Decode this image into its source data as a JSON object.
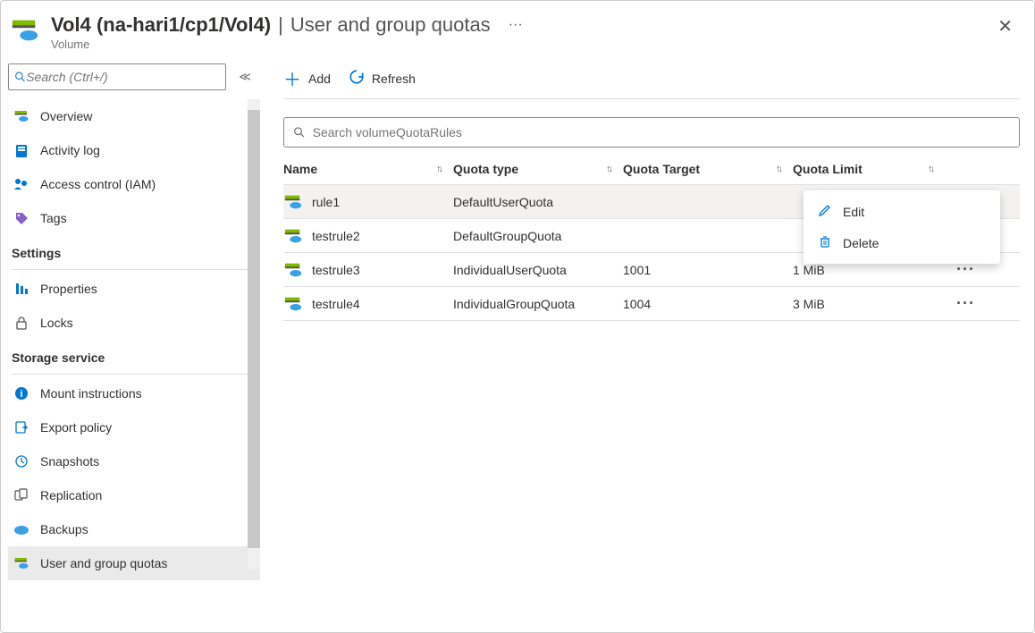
{
  "header": {
    "title_bold": "Vol4 (na-hari1/cp1/Vol4)",
    "title_sep": "|",
    "title_light": "User and group quotas",
    "subtitle": "Volume",
    "dots": "···",
    "close": "✕"
  },
  "sidebar": {
    "search_placeholder": "Search (Ctrl+/)",
    "items_top": [
      {
        "label": "Overview",
        "icon": "overview"
      },
      {
        "label": "Activity log",
        "icon": "activitylog"
      },
      {
        "label": "Access control (IAM)",
        "icon": "iam"
      },
      {
        "label": "Tags",
        "icon": "tags"
      }
    ],
    "section_settings": "Settings",
    "items_settings": [
      {
        "label": "Properties",
        "icon": "properties"
      },
      {
        "label": "Locks",
        "icon": "locks"
      }
    ],
    "section_storage": "Storage service",
    "items_storage": [
      {
        "label": "Mount instructions",
        "icon": "info"
      },
      {
        "label": "Export policy",
        "icon": "export"
      },
      {
        "label": "Snapshots",
        "icon": "snapshots"
      },
      {
        "label": "Replication",
        "icon": "replication"
      },
      {
        "label": "Backups",
        "icon": "backups"
      },
      {
        "label": "User and group quotas",
        "icon": "quotas",
        "active": true
      }
    ]
  },
  "toolbar": {
    "add": "Add",
    "refresh": "Refresh"
  },
  "main_search_placeholder": "Search volumeQuotaRules",
  "table": {
    "headers": [
      "Name",
      "Quota type",
      "Quota Target",
      "Quota Limit"
    ],
    "rows": [
      {
        "name": "rule1",
        "type": "DefaultUserQuota",
        "target": "",
        "limit": "",
        "highlight": true
      },
      {
        "name": "testrule2",
        "type": "DefaultGroupQuota",
        "target": "",
        "limit": ""
      },
      {
        "name": "testrule3",
        "type": "IndividualUserQuota",
        "target": "1001",
        "limit": "1 MiB"
      },
      {
        "name": "testrule4",
        "type": "IndividualGroupQuota",
        "target": "1004",
        "limit": "3 MiB"
      }
    ]
  },
  "context_menu": {
    "edit": "Edit",
    "delete": "Delete"
  }
}
